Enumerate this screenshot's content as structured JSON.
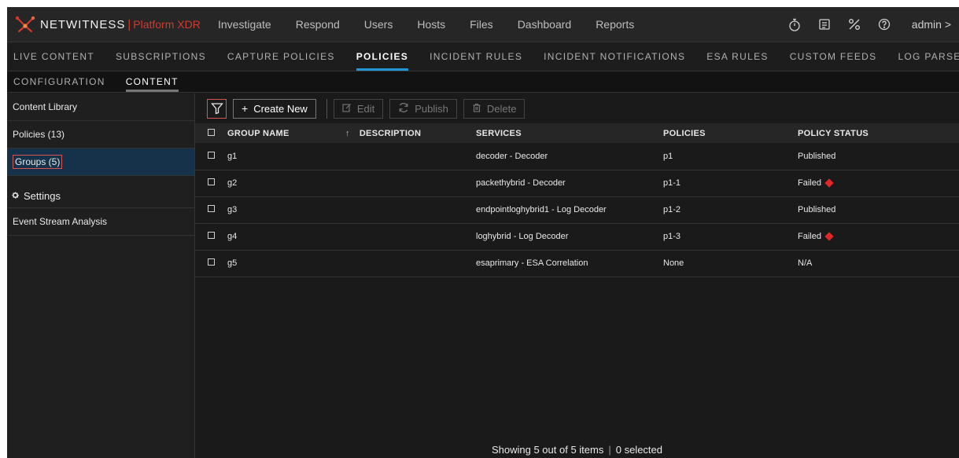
{
  "brand": {
    "name": "NETWITNESS",
    "separator": "|",
    "product": "Platform XDR",
    "accent_color": "#d03a2f"
  },
  "main_nav": [
    "Investigate",
    "Respond",
    "Users",
    "Hosts",
    "Files",
    "Dashboard",
    "Reports"
  ],
  "top_icons": [
    "stopwatch-icon",
    "notes-icon",
    "tools-icon",
    "help-icon"
  ],
  "user": {
    "label": "admin >"
  },
  "sub_nav": {
    "items": [
      "LIVE CONTENT",
      "SUBSCRIPTIONS",
      "CAPTURE POLICIES",
      "POLICIES",
      "INCIDENT RULES",
      "INCIDENT NOTIFICATIONS",
      "ESA RULES",
      "CUSTOM FEEDS",
      "LOG PARSER RULES"
    ],
    "active": "POLICIES",
    "active_color": "#2196d3"
  },
  "tabs": {
    "items": [
      "CONFIGURATION",
      "CONTENT"
    ],
    "active": "CONTENT"
  },
  "sidebar": {
    "items": [
      "Content Library",
      "Policies (13)",
      "Groups (5)"
    ],
    "selected": "Groups (5)",
    "section_label": "Settings",
    "section_items": [
      "Event Stream Analysis"
    ]
  },
  "toolbar": {
    "create_label": "Create New",
    "edit_label": "Edit",
    "publish_label": "Publish",
    "delete_label": "Delete"
  },
  "table": {
    "columns": [
      "GROUP NAME",
      "DESCRIPTION",
      "SERVICES",
      "POLICIES",
      "POLICY STATUS"
    ],
    "sort_indicator": "↑",
    "rows": [
      {
        "group": "g1",
        "description": "",
        "services": "decoder - Decoder",
        "policies": "p1",
        "status": "Published",
        "failed": false
      },
      {
        "group": "g2",
        "description": "",
        "services": "packethybrid - Decoder",
        "policies": "p1-1",
        "status": "Failed",
        "failed": true
      },
      {
        "group": "g3",
        "description": "",
        "services": "endpointloghybrid1 - Log Decoder",
        "policies": "p1-2",
        "status": "Published",
        "failed": false
      },
      {
        "group": "g4",
        "description": "",
        "services": "loghybrid - Log Decoder",
        "policies": "p1-3",
        "status": "Failed",
        "failed": true
      },
      {
        "group": "g5",
        "description": "",
        "services": "esaprimary - ESA Correlation",
        "policies": "None",
        "status": "N/A",
        "failed": false
      }
    ]
  },
  "footer": {
    "showing": "Showing 5 out of 5 items",
    "selected": "0 selected"
  }
}
